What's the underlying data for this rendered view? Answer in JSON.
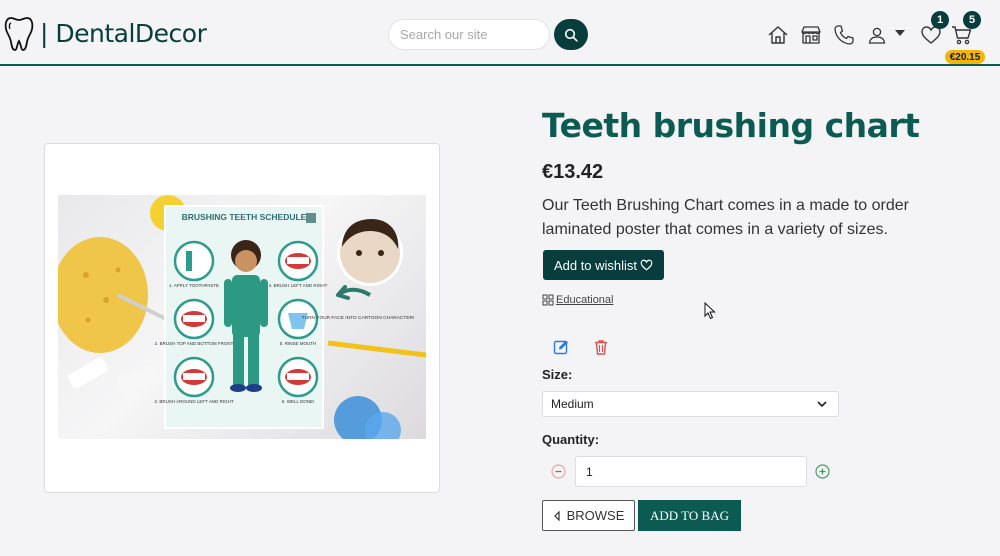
{
  "header": {
    "logo_text": "| DentalDecor",
    "search_placeholder": "Search our site",
    "wishlist_count": "1",
    "cart_count": "5",
    "cart_total": "€20.15"
  },
  "product": {
    "title": "Teeth brushing chart",
    "price": "€13.42",
    "description": "Our Teeth Brushing Chart comes in a made to order laminated poster that comes in a variety of sizes.",
    "wishlist_label": "Add to wishlist",
    "category": "Educational",
    "size_label": "Size:",
    "size_value": "Medium",
    "quantity_label": "Quantity:",
    "quantity_value": "1",
    "browse_label": "BROWSE",
    "add_label": "ADD TO BAG"
  },
  "poster": {
    "title": "BRUSHING TEETH SCHEDULE",
    "steps": [
      "1. APPLY TOOTHPASTE",
      "2. BRUSH TOP AND BOTTOM FRONT",
      "3. BRUSH AROUND LEFT AND RIGHT",
      "4. BRUSH LEFT AND RIGHT",
      "5. RINSE MOUTH",
      "6. WELL DONE!"
    ],
    "side_note": "TURN YOUR FACE INTO CARTOON CHARACTER!"
  },
  "colors": {
    "brand": "#073d3d",
    "accent": "#0c5b52",
    "badge": "#f2b60a",
    "delete": "#d9534f",
    "edit": "#2a7ae2"
  },
  "icons": [
    "tooth-logo-icon",
    "search-icon",
    "home-icon",
    "store-icon",
    "phone-icon",
    "user-icon",
    "heart-icon",
    "cart-icon",
    "edit-icon",
    "trash-icon",
    "minus-icon",
    "plus-icon",
    "chevron-down-icon",
    "chevron-left-icon",
    "tag-icon"
  ]
}
